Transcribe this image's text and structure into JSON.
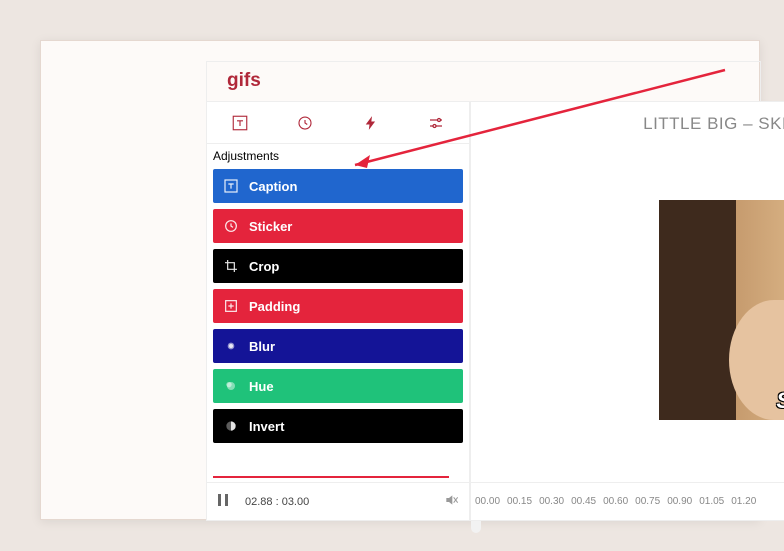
{
  "brand": "gifs",
  "sidebar": {
    "section_label": "Adjustments",
    "items": [
      {
        "label": "Caption",
        "color": "bg-blue"
      },
      {
        "label": "Sticker",
        "color": "bg-red"
      },
      {
        "label": "Crop",
        "color": "bg-black"
      },
      {
        "label": "Padding",
        "color": "bg-red2"
      },
      {
        "label": "Blur",
        "color": "bg-dblue"
      },
      {
        "label": "Hue",
        "color": "bg-green"
      },
      {
        "label": "Invert",
        "color": "bg-black2"
      }
    ]
  },
  "player": {
    "time": "02.88 : 03.00"
  },
  "preview": {
    "title": "LITTLE BIG – SKIB",
    "caption_letter": "S"
  },
  "timeline": {
    "marks": [
      "00.00",
      "00.15",
      "00.30",
      "00.45",
      "00.60",
      "00.75",
      "00.90",
      "01.05",
      "01.20"
    ]
  }
}
